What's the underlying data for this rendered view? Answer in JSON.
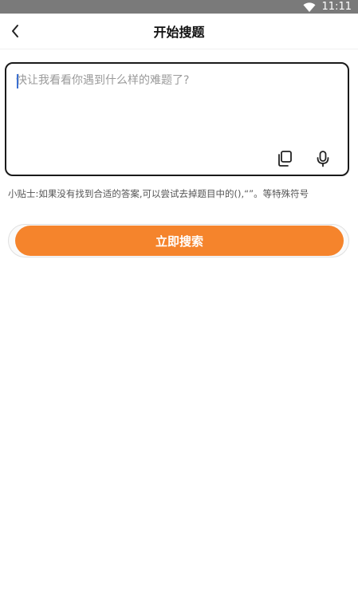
{
  "status_bar": {
    "time": "11:11",
    "wifi_icon": "wifi-icon"
  },
  "header": {
    "title": "开始搜题",
    "back_icon": "chevron-left-icon"
  },
  "question": {
    "placeholder": "快让我看看你遇到什么样的难题了?",
    "value": "",
    "tools": [
      {
        "icon": "copy-icon"
      },
      {
        "icon": "microphone-icon"
      }
    ]
  },
  "tip": {
    "text": "小贴士:如果没有找到合适的答案,可以尝试去掉题目中的(),“”。等特殊符号"
  },
  "search": {
    "label": "立即搜索",
    "color": "#f5842c"
  }
}
